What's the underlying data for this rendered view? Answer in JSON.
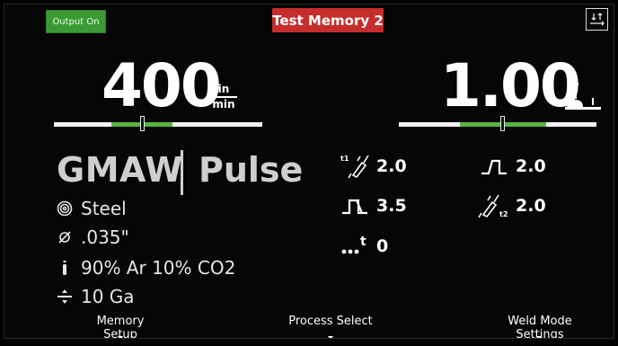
{
  "header": {
    "output_status": "Output On",
    "memory_name": "Test Memory 2"
  },
  "wire_feed_speed": {
    "value": "400",
    "unit_numerator": "in",
    "unit_denominator": "min"
  },
  "voltage": {
    "value": "1.00",
    "icon": "trim-icon"
  },
  "process": {
    "name": "GMAW",
    "mode": "Pulse"
  },
  "specs": [
    {
      "icon": "material-icon",
      "text": "Steel"
    },
    {
      "icon": "wire-diameter-icon",
      "text": ".035\""
    },
    {
      "icon": "gas-icon",
      "text": "90% Ar 10% CO2"
    },
    {
      "icon": "thickness-icon",
      "text": "10 Ga"
    }
  ],
  "params": {
    "preflow": {
      "icon": "torch-t1-icon",
      "value": "2.0"
    },
    "start": {
      "icon": "pulse-start-icon",
      "value": "3.5"
    },
    "crater": {
      "icon": "pulse-end-icon",
      "value": "2.0"
    },
    "postflow": {
      "icon": "torch-t2-icon",
      "value": "2.0"
    },
    "time": {
      "icon": "dots-t-icon",
      "value": "0"
    }
  },
  "menu": {
    "memory_setup": "Memory Setup",
    "process_select": "Process Select",
    "weld_mode_settings": "Weld Mode Settings"
  },
  "colors": {
    "output_on": "#3c9a35",
    "memory": "#c62d2d",
    "slider_track": "#f2f2f2",
    "slider_range": "#55b53f",
    "process_text": "#cfcfcf",
    "background": "#060606"
  }
}
